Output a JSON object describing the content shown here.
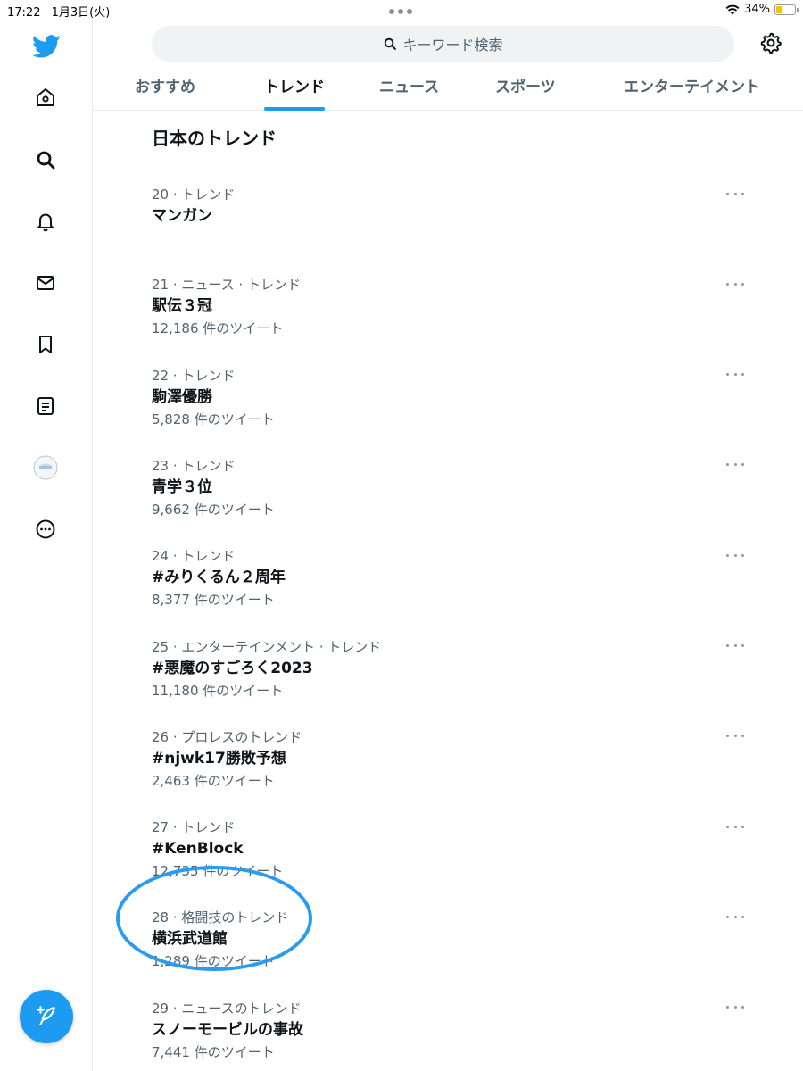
{
  "status_bar": {
    "time": "17:22",
    "date": "1月3日(火)",
    "battery": "34%",
    "battery_level": 0.34
  },
  "search": {
    "placeholder": "キーワード検索"
  },
  "tabs": [
    {
      "label": "おすすめ"
    },
    {
      "label": "トレンド"
    },
    {
      "label": "ニュース"
    },
    {
      "label": "スポーツ"
    },
    {
      "label": "エンターテイメント"
    }
  ],
  "active_tab": "トレンド",
  "section_title": "日本のトレンド",
  "trends": [
    {
      "meta": "20 · トレンド",
      "name": "マンガン",
      "count": ""
    },
    {
      "meta": "21 · ニュース · トレンド",
      "name": "駅伝３冠",
      "count": "12,186 件のツイート"
    },
    {
      "meta": "22 · トレンド",
      "name": "駒澤優勝",
      "count": "5,828 件のツイート"
    },
    {
      "meta": "23 · トレンド",
      "name": "青学３位",
      "count": "9,662 件のツイート"
    },
    {
      "meta": "24 · トレンド",
      "name": "#みりくるん２周年",
      "count": "8,377 件のツイート"
    },
    {
      "meta": "25 · エンターテインメント · トレンド",
      "name": "#悪魔のすごろく2023",
      "count": "11,180 件のツイート"
    },
    {
      "meta": "26 · プロレスのトレンド",
      "name": "#njwk17勝敗予想",
      "count": "2,463 件のツイート"
    },
    {
      "meta": "27 · トレンド",
      "name": "#KenBlock",
      "count": "12,735 件のツイート"
    },
    {
      "meta": "28 · 格闘技のトレンド",
      "name": "横浜武道館",
      "count": "1,289 件のツイート"
    },
    {
      "meta": "29 · ニュースのトレンド",
      "name": "スノーモービルの事故",
      "count": "7,441 件のツイート"
    }
  ],
  "colors": {
    "accent": "#1d9bf0",
    "annotation": "#2a9cf0"
  },
  "icons": [
    "twitter-logo-icon",
    "home-icon",
    "search-icon",
    "notifications-icon",
    "messages-icon",
    "bookmarks-icon",
    "lists-icon",
    "profile-avatar",
    "more-icon",
    "compose-tweet-icon",
    "settings-icon",
    "wifi-icon",
    "battery-icon"
  ]
}
